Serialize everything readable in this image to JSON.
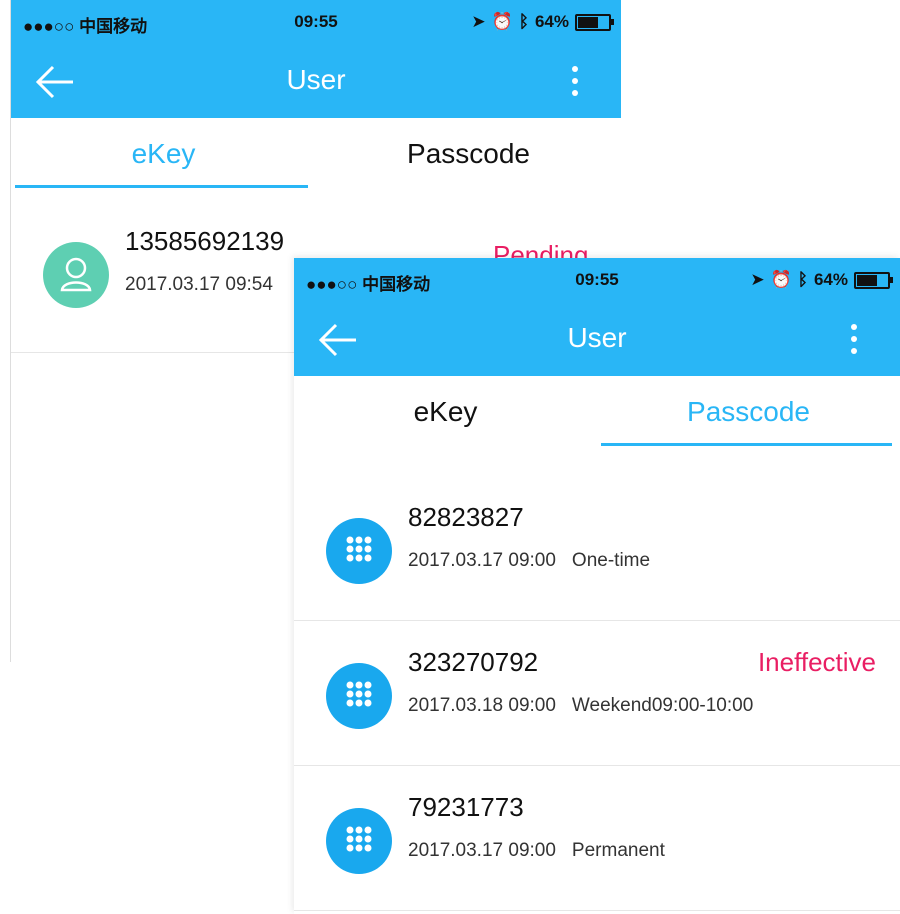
{
  "screens": [
    {
      "status": {
        "carrier": "●●●○○ 中国移动",
        "time": "09:55",
        "battery": "64%"
      },
      "nav": {
        "title": "User"
      },
      "tabs": [
        {
          "label": "eKey",
          "active": true
        },
        {
          "label": "Passcode",
          "active": false
        }
      ],
      "rows": [
        {
          "title": "13585692139",
          "date": "2017.03.17 09:54",
          "status": "Pending"
        }
      ]
    },
    {
      "status": {
        "carrier": "●●●○○ 中国移动",
        "time": "09:55",
        "battery": "64%"
      },
      "nav": {
        "title": "User"
      },
      "tabs": [
        {
          "label": "eKey",
          "active": false
        },
        {
          "label": "Passcode",
          "active": true
        }
      ],
      "rows": [
        {
          "title": "82823827",
          "date": "2017.03.17 09:00",
          "type": "One-time",
          "status": ""
        },
        {
          "title": "323270792",
          "date": "2017.03.18 09:00",
          "type": "Weekend09:00-10:00",
          "status": "Ineffective"
        },
        {
          "title": "79231773",
          "date": "2017.03.17 09:00",
          "type": "Permanent",
          "status": ""
        }
      ]
    }
  ],
  "colors": {
    "accent": "#29b6f6",
    "status_red": "#e91e63",
    "user_avatar": "#5ecfb2",
    "passcode_avatar": "#19a8ee"
  }
}
